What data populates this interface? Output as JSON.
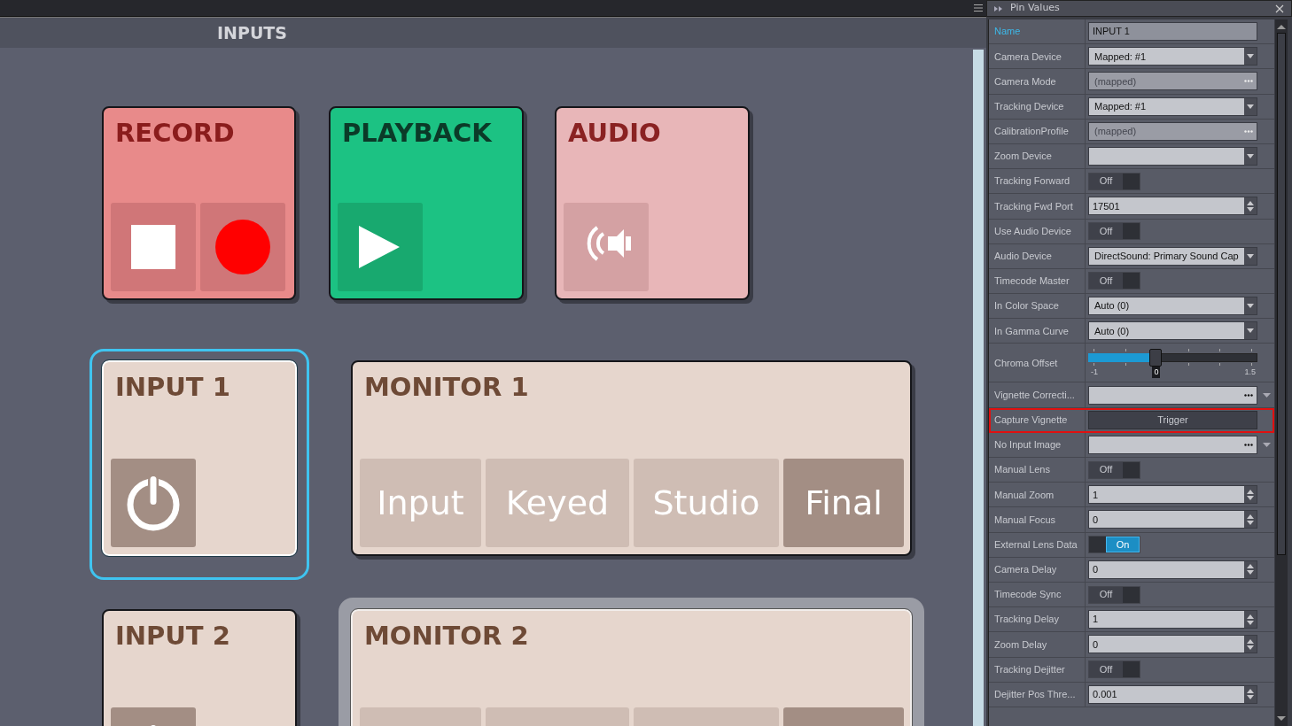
{
  "canvas": {
    "title": "INPUTS",
    "cards": [
      {
        "kind": "record",
        "title": "RECORD",
        "selected": false,
        "hovered": false,
        "buttons": [
          {
            "active": false
          },
          {
            "active": false
          }
        ]
      },
      {
        "kind": "playback",
        "title": "PLAYBACK",
        "selected": false,
        "hovered": false,
        "buttons": [
          {
            "active": false
          }
        ]
      },
      {
        "kind": "audio",
        "title": "AUDIO",
        "selected": false,
        "hovered": false,
        "buttons": [
          {
            "active": false
          }
        ]
      },
      {
        "kind": "input",
        "title": "INPUT 1",
        "selected": true,
        "hovered": false,
        "buttons": [
          {
            "active": true
          }
        ]
      },
      {
        "kind": "monitor",
        "title": "MONITOR 1",
        "selected": false,
        "hovered": false,
        "buttons": [
          {
            "label": "Input",
            "active": false
          },
          {
            "label": "Keyed",
            "active": false
          },
          {
            "label": "Studio",
            "active": false
          },
          {
            "label": "Final",
            "active": true
          }
        ]
      },
      {
        "kind": "input",
        "title": "INPUT 2",
        "selected": false,
        "hovered": false,
        "buttons": [
          {
            "active": true
          }
        ]
      },
      {
        "kind": "monitor",
        "title": "MONITOR 2",
        "selected": false,
        "hovered": true,
        "buttons": [
          {
            "active": false
          },
          {
            "active": false
          },
          {
            "active": false
          },
          {
            "active": true
          }
        ]
      }
    ]
  },
  "panel": {
    "title": "Pin Values",
    "rows": [
      {
        "kind": "text",
        "label": "Name",
        "value": "INPUT 1",
        "focused": true
      },
      {
        "kind": "dropdown",
        "label": "Camera Device",
        "value": "Mapped: #1"
      },
      {
        "kind": "ellipsis",
        "label": "Camera Mode",
        "placeholder": "(mapped)",
        "disabled": true
      },
      {
        "kind": "dropdown",
        "label": "Tracking Device",
        "value": "Mapped: #1"
      },
      {
        "kind": "ellipsis",
        "label": "CalibrationProfile",
        "placeholder": "(mapped)",
        "disabled": true
      },
      {
        "kind": "dropdown",
        "label": "Zoom Device"
      },
      {
        "kind": "toggle",
        "label": "Tracking Forward",
        "value": "Off",
        "on": false
      },
      {
        "kind": "spin",
        "label": "Tracking Fwd Port",
        "value": "17501"
      },
      {
        "kind": "toggle",
        "label": "Use Audio Device",
        "value": "Off",
        "on": false
      },
      {
        "kind": "dropdown",
        "label": "Audio Device",
        "value": "DirectSound: Primary Sound Cap"
      },
      {
        "kind": "toggle",
        "label": "Timecode Master",
        "value": "Off",
        "on": false
      },
      {
        "kind": "dropdown",
        "label": "In Color Space",
        "value": "Auto (0)"
      },
      {
        "kind": "dropdown",
        "label": "In Gamma Curve",
        "value": "Auto (0)"
      },
      {
        "kind": "slider",
        "label": "Chroma Offset",
        "level": 0.4,
        "min": "-1",
        "reading": "0",
        "max": "1.5"
      },
      {
        "kind": "ellipsis",
        "label": "Vignette Correcti...",
        "disabled": false,
        "expandable": true
      },
      {
        "kind": "button",
        "label": "Capture Vignette",
        "value": "Trigger",
        "highlighted": true
      },
      {
        "kind": "ellipsis",
        "label": "No Input Image",
        "disabled": false,
        "expandable": true
      },
      {
        "kind": "toggle",
        "label": "Manual Lens",
        "value": "Off",
        "on": false
      },
      {
        "kind": "spin",
        "label": "Manual Zoom",
        "value": "1"
      },
      {
        "kind": "spin",
        "label": "Manual Focus",
        "value": "0"
      },
      {
        "kind": "toggle",
        "label": "External Lens Data",
        "value": "On",
        "on": true
      },
      {
        "kind": "spin",
        "label": "Camera Delay",
        "value": "0"
      },
      {
        "kind": "toggle",
        "label": "Timecode Sync",
        "value": "Off",
        "on": false
      },
      {
        "kind": "spin",
        "label": "Tracking Delay",
        "value": "1"
      },
      {
        "kind": "spin",
        "label": "Zoom Delay",
        "value": "0"
      },
      {
        "kind": "toggle",
        "label": "Tracking Dejitter",
        "value": "Off",
        "on": false
      },
      {
        "kind": "spin",
        "label": "Dejitter Pos Thre...",
        "value": "0.001"
      }
    ]
  }
}
